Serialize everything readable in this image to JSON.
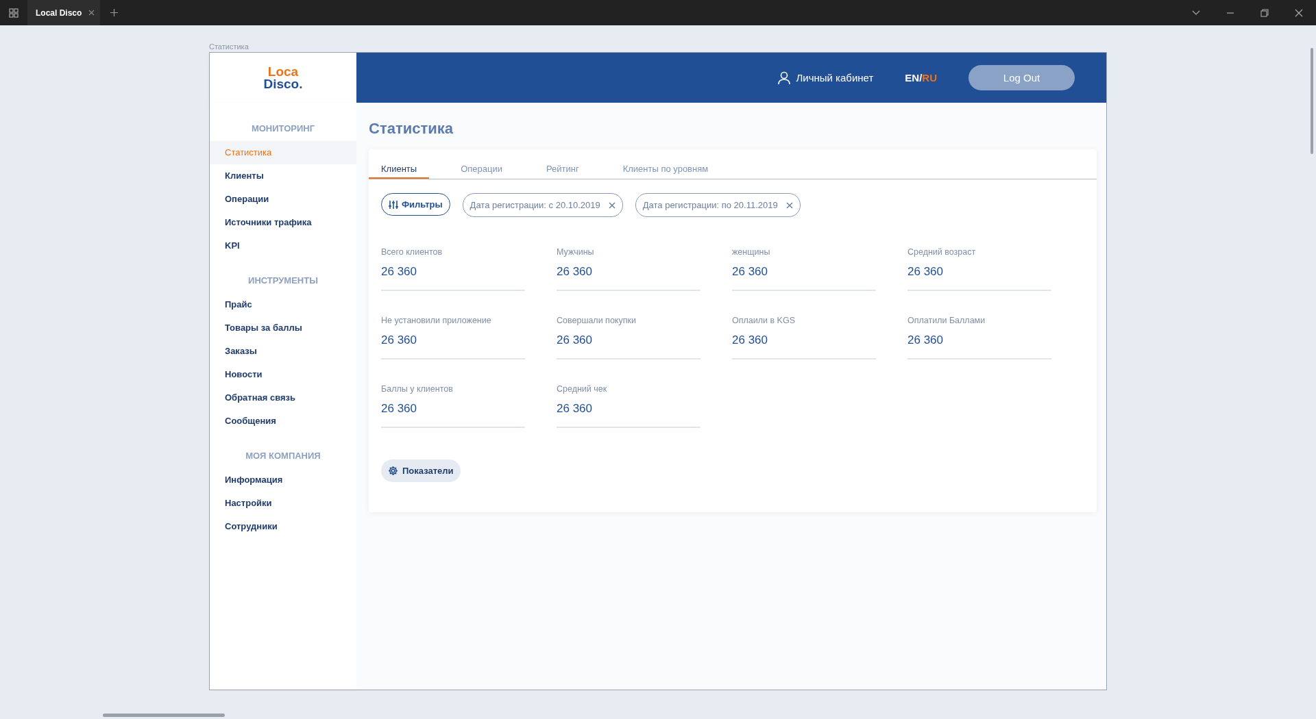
{
  "browser": {
    "tabs": [
      {
        "title": "Local Disco",
        "selected": true
      }
    ]
  },
  "breadcrumb": "Статистика",
  "header": {
    "logo": {
      "line1": "Loca",
      "line2": "Disco."
    },
    "account": "Личный кабинет",
    "separator": "/",
    "languages": [
      {
        "label": "EN",
        "selected": false
      },
      {
        "label": "RU",
        "selected": true
      }
    ],
    "logout": "Log Out"
  },
  "sidebar": {
    "sections": [
      {
        "heading": "МОНИТОРИНГ",
        "items": [
          {
            "label": "Статистика",
            "selected": true
          },
          {
            "label": "Клиенты",
            "selected": false
          },
          {
            "label": "Операции",
            "selected": false
          },
          {
            "label": "Источники трафика",
            "selected": false
          },
          {
            "label": "KPI",
            "selected": false
          }
        ]
      },
      {
        "heading": "ИНСТРУМЕНТЫ",
        "items": [
          {
            "label": "Прайс",
            "selected": false
          },
          {
            "label": "Товары за баллы",
            "selected": false
          },
          {
            "label": "Заказы",
            "selected": false
          },
          {
            "label": "Новости",
            "selected": false
          },
          {
            "label": "Обратная связь",
            "selected": false
          },
          {
            "label": "Сообщения",
            "selected": false
          }
        ]
      },
      {
        "heading": "МОЯ КОМПАНИЯ",
        "items": [
          {
            "label": "Информация",
            "selected": false
          },
          {
            "label": "Настройки",
            "selected": false
          },
          {
            "label": "Сотрудники",
            "selected": false
          }
        ]
      }
    ]
  },
  "page_title": "Статистика",
  "tabs": [
    {
      "label": "Клиенты",
      "selected": true
    },
    {
      "label": "Операции",
      "selected": false
    },
    {
      "label": "Рейтинг",
      "selected": false
    },
    {
      "label": "Клиенты по уровням",
      "selected": false
    }
  ],
  "filters": {
    "button": "Фильтры",
    "chips": [
      "Дата регистрации: с 20.10.2019",
      "Дата регистрации: по 20.11.2019"
    ]
  },
  "metrics": [
    {
      "label": "Всего клиентов",
      "value": "26 360"
    },
    {
      "label": "Мужчины",
      "value": "26 360"
    },
    {
      "label": "женщины",
      "value": "26 360"
    },
    {
      "label": "Средний возраст",
      "value": "26 360"
    },
    {
      "label": "Не установили приложение",
      "value": "26 360"
    },
    {
      "label": "Совершали покупки",
      "value": "26 360"
    },
    {
      "label": "Оплаили в KGS",
      "value": "26 360"
    },
    {
      "label": "Оплатили Баллами",
      "value": "26 360"
    },
    {
      "label": "Баллы у клиентов",
      "value": "26 360"
    },
    {
      "label": "Средний чек",
      "value": "26 360"
    }
  ],
  "indicators_button": "Показатели"
}
